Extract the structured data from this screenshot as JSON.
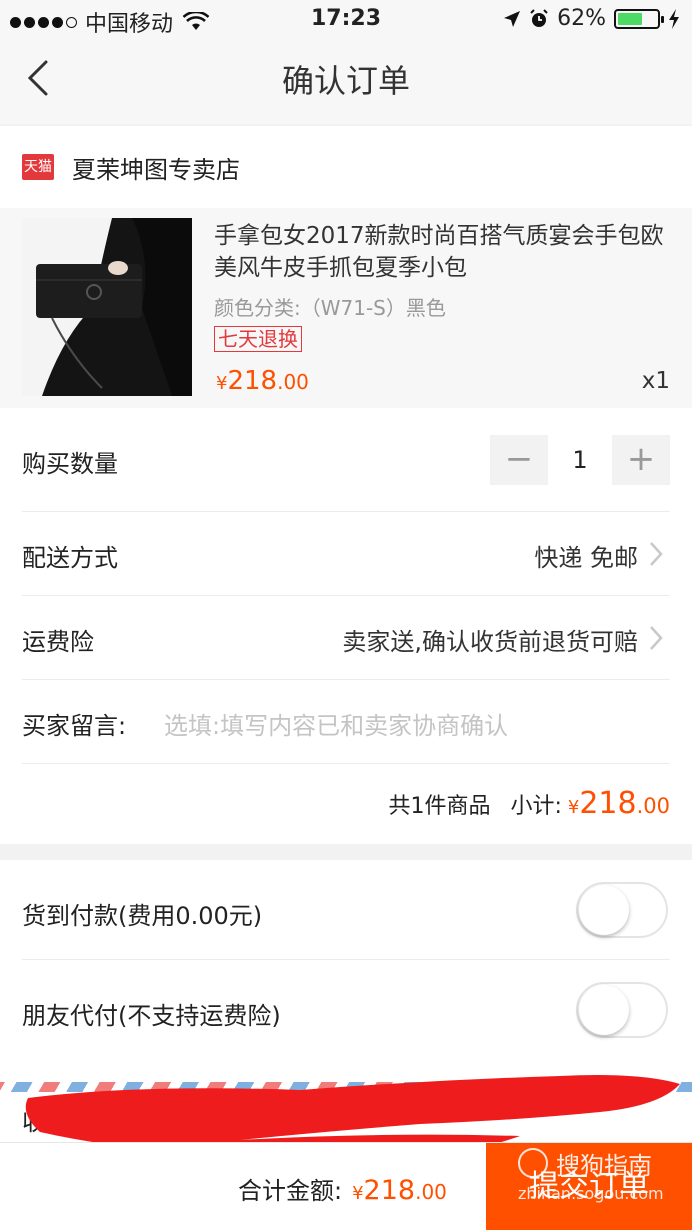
{
  "status_bar": {
    "carrier": "中国移动",
    "time": "17:23",
    "battery": "62%",
    "battery_level": 0.62
  },
  "nav": {
    "title": "确认订单",
    "back_icon": "chevron-left-icon"
  },
  "store": {
    "badge": "天猫",
    "name": "夏茉坤图专卖店"
  },
  "product": {
    "title": "手拿包女2017新款时尚百搭气质宴会手包欧美风牛皮手抓包夏季小包",
    "spec": "颜色分类:（W71-S）黑色",
    "badge": "七天退换",
    "price_currency": "¥",
    "price_int": "218",
    "price_dec": ".00",
    "quantity": "x1"
  },
  "order": {
    "qty_label": "购买数量",
    "qty_minus": "−",
    "qty_value": "1",
    "qty_plus": "+",
    "delivery_label": "配送方式",
    "delivery_value": "快递 免邮",
    "insurance_label": "运费险",
    "insurance_value": "卖家送,确认收货前退货可赔",
    "message_label": "买家留言:",
    "message_placeholder": "选填:填写内容已和卖家协商确认",
    "items_count": "共1件商品",
    "subtotal_label": "小计:",
    "subtotal_currency": "¥",
    "subtotal_int": "218",
    "subtotal_dec": ".00"
  },
  "payment": {
    "cod_label": "货到付款(费用0.00元)",
    "cod_on": false,
    "friend_label": "朋友代付(不支持运费险)",
    "friend_on": false
  },
  "address": {
    "label": "收货"
  },
  "footer": {
    "total_label": "合计金额:",
    "total_currency": "¥",
    "total_int": "218",
    "total_dec": ".00",
    "submit_label": "提交订单"
  },
  "watermark": {
    "brand": "搜狗指南",
    "url": "zhinan.sogou.com"
  },
  "colors": {
    "accent": "#ff5000",
    "tmall_red": "#e4393c",
    "battery_green": "#4cd964"
  }
}
